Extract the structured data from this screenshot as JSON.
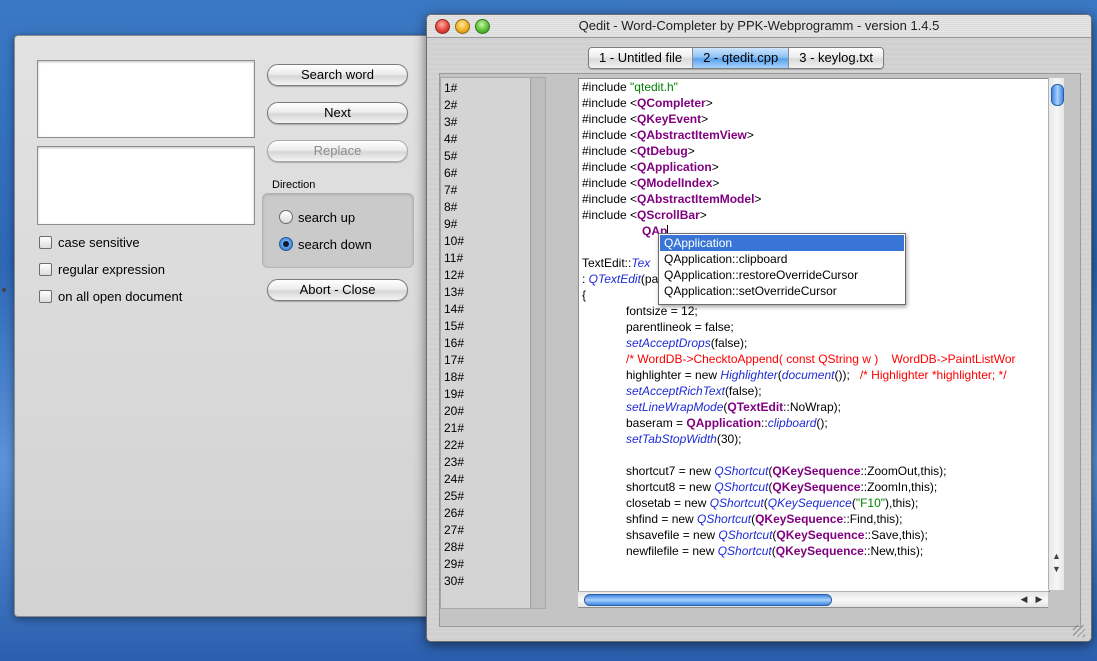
{
  "find_panel": {
    "buttons": {
      "search_word": "Search word",
      "next": "Next",
      "replace": "Replace",
      "abort_close": "Abort - Close"
    },
    "direction": {
      "label": "Direction",
      "options": [
        "search up",
        "search down"
      ],
      "selected": "search down"
    },
    "options": {
      "case_sensitive": "case sensitive",
      "regular_expression": "regular expression",
      "on_all_open_document": "on all open document"
    }
  },
  "main_window": {
    "title": "Qedit - Word-Completer by PPK-Webprogramm - version 1.4.5",
    "tabs": [
      {
        "label": "1 - Untitled file",
        "active": false
      },
      {
        "label": "2 - qtedit.cpp",
        "active": true
      },
      {
        "label": "3 - keylog.txt",
        "active": false
      }
    ],
    "line_numbers": [
      "1#",
      "2#",
      "3#",
      "4#",
      "5#",
      "6#",
      "7#",
      "8#",
      "9#",
      "10#",
      "11#",
      "12#",
      "13#",
      "14#",
      "15#",
      "16#",
      "17#",
      "18#",
      "19#",
      "20#",
      "21#",
      "22#",
      "23#",
      "24#",
      "25#",
      "26#",
      "27#",
      "28#",
      "29#",
      "30#"
    ],
    "code": {
      "l1": [
        "#include ",
        "\"qtedit.h\""
      ],
      "l2": [
        "#include <",
        "QCompleter",
        ">"
      ],
      "l3": [
        "#include <",
        "QKeyEvent",
        ">"
      ],
      "l4": [
        "#include <",
        "QAbstractItemView",
        ">"
      ],
      "l5": [
        "#include <",
        "QtDebug",
        ">"
      ],
      "l6": [
        "#include <",
        "QApplication",
        ">"
      ],
      "l7": [
        "#include <",
        "QModelIndex",
        ">"
      ],
      "l8": [
        "#include <",
        "QAbstractItemModel",
        ">"
      ],
      "l9": [
        "#include <",
        "QScrollBar",
        ">"
      ],
      "l10": [
        "QAp"
      ],
      "l12": [
        "TextEdit::",
        "Tex"
      ],
      "l13": [
        ": ",
        "QTextEdit",
        "(pa"
      ],
      "l14": [
        "{"
      ],
      "l15": [
        "fontsize = 12;"
      ],
      "l16": [
        "parentlineok = false;"
      ],
      "l17": [
        "setAcceptDrops",
        "(false);"
      ],
      "l18": [
        "/* WordDB->ChecktoAppend( const QString w )    WordDB->PaintListWor"
      ],
      "l19": [
        "highlighter = new ",
        "Highlighter",
        "(",
        "document",
        "());   ",
        "/* Highlighter *highlighter; */"
      ],
      "l20": [
        "setAcceptRichText",
        "(false);"
      ],
      "l21": [
        "setLineWrapMode",
        "(",
        "QTextEdit",
        "::NoWrap);"
      ],
      "l22": [
        "baseram = ",
        "QApplication",
        "::",
        "clipboard",
        "();"
      ],
      "l23": [
        "setTabStopWidth",
        "(30);"
      ],
      "l25": [
        "shortcut7 = new ",
        "QShortcut",
        "(",
        "QKeySequence",
        "::ZoomOut,this);"
      ],
      "l26": [
        "shortcut8 = new ",
        "QShortcut",
        "(",
        "QKeySequence",
        "::ZoomIn,this);"
      ],
      "l27": [
        "closetab = new ",
        "QShortcut",
        "(",
        "QKeySequence",
        "(",
        "\"F10\"",
        "),this);"
      ],
      "l28": [
        "shfind = new ",
        "QShortcut",
        "(",
        "QKeySequence",
        "::Find,this);"
      ],
      "l29": [
        "shsavefile = new ",
        "QShortcut",
        "(",
        "QKeySequence",
        "::Save,this);"
      ],
      "l30": [
        "newfilefile = new ",
        "QShortcut",
        "(",
        "QKeySequence",
        "::New,this);"
      ]
    },
    "completer": {
      "items": [
        "QApplication",
        "QApplication::clipboard",
        "QApplication::restoreOverrideCursor",
        "QApplication::setOverrideCursor"
      ],
      "selected_index": 0
    },
    "colors": {
      "class_purple": "#800080",
      "function_blue": "#1f2bd6",
      "string_green": "#008000",
      "comment_red": "#ff0000",
      "selection_blue": "#3875d7"
    }
  }
}
